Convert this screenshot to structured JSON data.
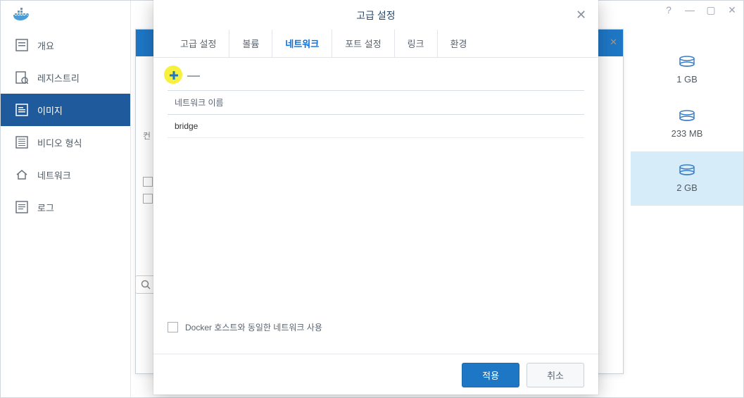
{
  "sidebar": {
    "items": [
      {
        "label": "개요"
      },
      {
        "label": "레지스트리"
      },
      {
        "label": "이미지"
      },
      {
        "label": "비디오 형식"
      },
      {
        "label": "네트워크"
      },
      {
        "label": "로그"
      }
    ]
  },
  "innerToolbar": {
    "indicator": "컨"
  },
  "storage": {
    "items": [
      {
        "size": "1 GB"
      },
      {
        "size": "233 MB"
      },
      {
        "size": "2 GB"
      }
    ]
  },
  "modal": {
    "title": "고급 설정",
    "tabs": [
      {
        "label": "고급 설정"
      },
      {
        "label": "볼륨"
      },
      {
        "label": "네트워크"
      },
      {
        "label": "포트 설정"
      },
      {
        "label": "링크"
      },
      {
        "label": "환경"
      }
    ],
    "networkTable": {
      "header": "네트워크 이름",
      "rows": [
        {
          "name": "bridge"
        }
      ]
    },
    "useHostNetworkLabel": "Docker 호스트와 동일한 네트워크 사용",
    "applyButton": "적용",
    "cancelButton": "취소"
  }
}
